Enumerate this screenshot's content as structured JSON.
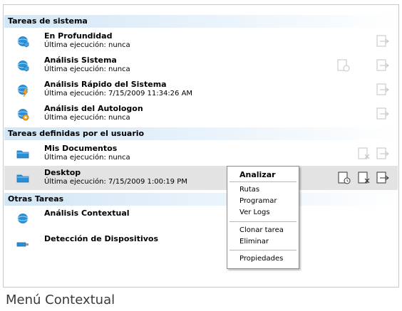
{
  "sections": [
    {
      "title": "Tareas de sistema",
      "tasks": [
        {
          "name": "En Profundidad",
          "status": "Última ejecución: nunca",
          "icon": "globe-shield-icon"
        },
        {
          "name": "Análisis Sistema",
          "status": "Última ejecución: nunca",
          "icon": "globe-shield-icon"
        },
        {
          "name": "Análisis Rápido del Sistema",
          "status": "Última ejecución: 7/15/2009 11:34:26 AM",
          "icon": "globe-lightning-icon"
        },
        {
          "name": "Análisis del Autologon",
          "status": "Última ejecución: nunca",
          "icon": "globe-gear-icon"
        }
      ]
    },
    {
      "title": "Tareas definidas por el usuario",
      "tasks": [
        {
          "name": "Mis Documentos",
          "status": "Última ejecución: nunca",
          "icon": "folder-icon"
        },
        {
          "name": "Desktop",
          "status": "Última ejecución: 7/15/2009 1:00:19 PM",
          "icon": "folder-icon"
        }
      ]
    },
    {
      "title": "Otras Tareas",
      "tasks": [
        {
          "name": "Análisis Contextual",
          "icon": "globe-icon"
        },
        {
          "name": "Detección de Dispositivos",
          "icon": "usb-icon"
        }
      ]
    }
  ],
  "context_menu": {
    "items": [
      "Analizar",
      "Rutas",
      "Programar",
      "Ver Logs",
      "Clonar tarea",
      "Eliminar",
      "Propiedades"
    ]
  },
  "caption": "Menú Contextual",
  "colors": {
    "header_gradient": "#d2e6f5",
    "selected_row": "#e3e3e3",
    "icon_blue": "#2b8fd6"
  }
}
